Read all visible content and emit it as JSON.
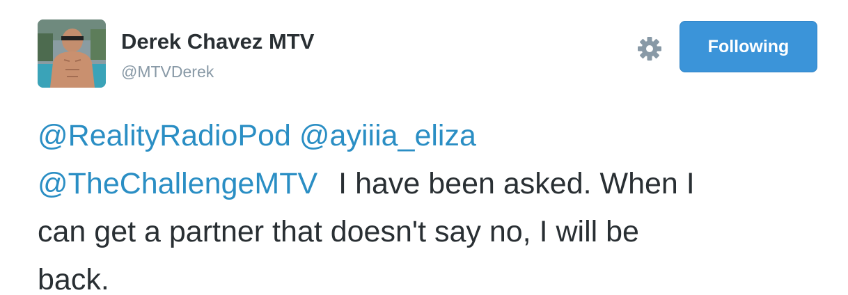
{
  "author": {
    "display_name": "Derek Chavez MTV",
    "handle": "@MTVDerek"
  },
  "actions": {
    "settings_icon": "gear-icon",
    "follow_label": "Following"
  },
  "tweet": {
    "mentions": [
      "@RealityRadioPod",
      "@ayiiia_eliza",
      "@TheChallengeMTV"
    ],
    "text_line_2": "I have been asked. When I",
    "text_line_3": "can get a partner that doesn't say no, I will be",
    "text_line_4": "back."
  },
  "colors": {
    "button_bg": "#3b94d9",
    "mention": "#2a8ec4",
    "text": "#292f33",
    "handle": "#8899a6"
  }
}
